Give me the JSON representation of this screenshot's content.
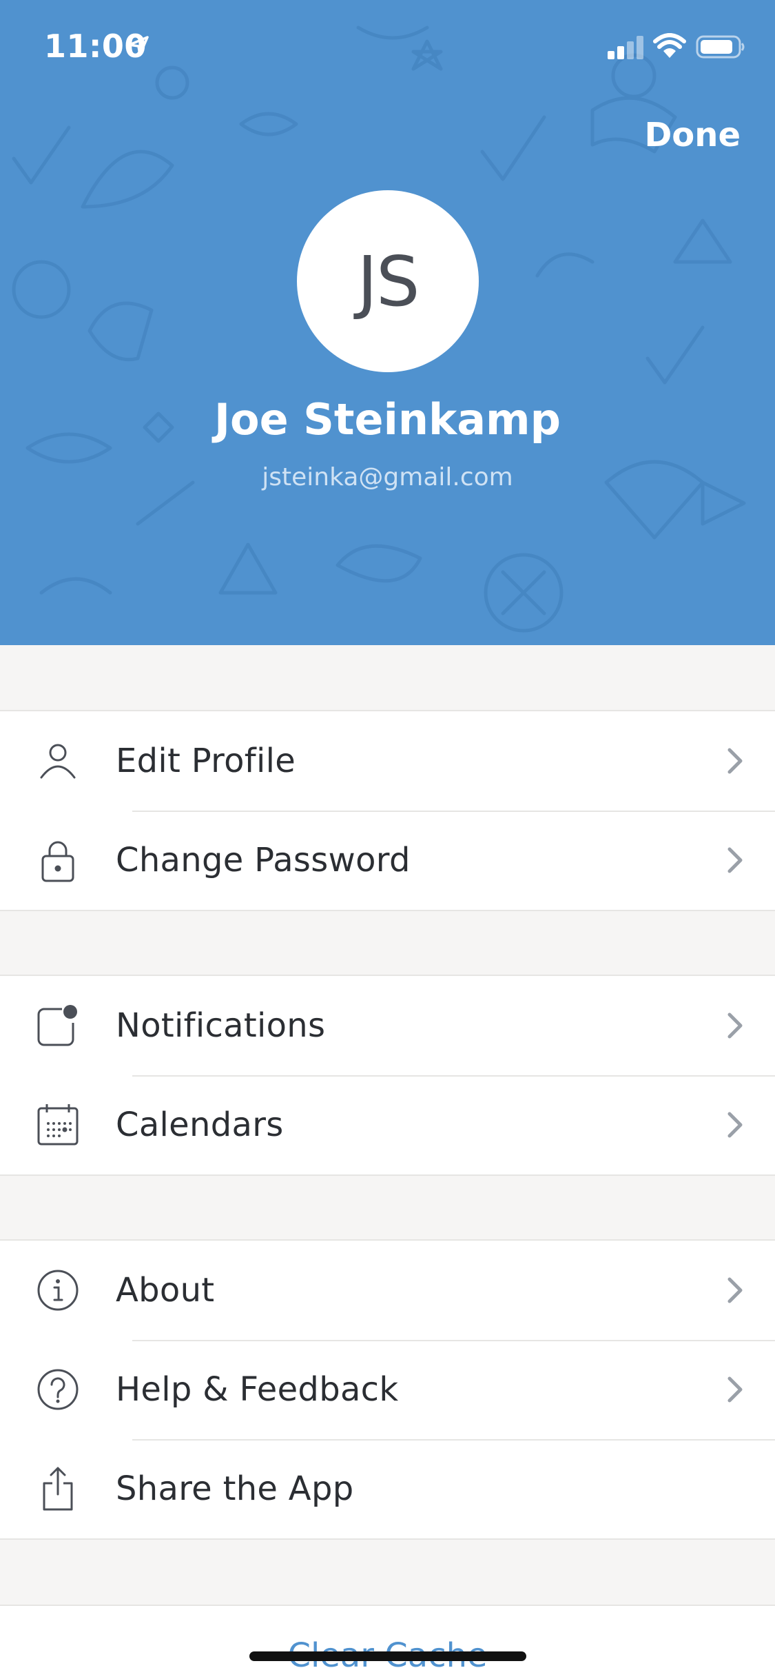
{
  "status_bar": {
    "time": "11:00"
  },
  "header": {
    "done_label": "Done",
    "avatar_initials": "JS",
    "name": "Joe Steinkamp",
    "email": "jsteinka@gmail.com",
    "background_color": "#5092cf"
  },
  "groups": [
    {
      "items": [
        {
          "label": "Edit Profile",
          "icon": "person-icon",
          "chevron": true
        },
        {
          "label": "Change Password",
          "icon": "lock-icon",
          "chevron": true
        }
      ]
    },
    {
      "items": [
        {
          "label": "Notifications",
          "icon": "notification-badge-icon",
          "chevron": true
        },
        {
          "label": "Calendars",
          "icon": "calendar-icon",
          "chevron": true
        }
      ]
    },
    {
      "items": [
        {
          "label": "About",
          "icon": "info-icon",
          "chevron": true
        },
        {
          "label": "Help & Feedback",
          "icon": "question-icon",
          "chevron": true
        },
        {
          "label": "Share the App",
          "icon": "share-icon",
          "chevron": false
        }
      ]
    }
  ],
  "footer": {
    "clear_cache_label": "Clear Cache"
  },
  "colors": {
    "accent": "#5092cf",
    "text": "#2b2e33",
    "chevron": "#9aa0a8"
  }
}
